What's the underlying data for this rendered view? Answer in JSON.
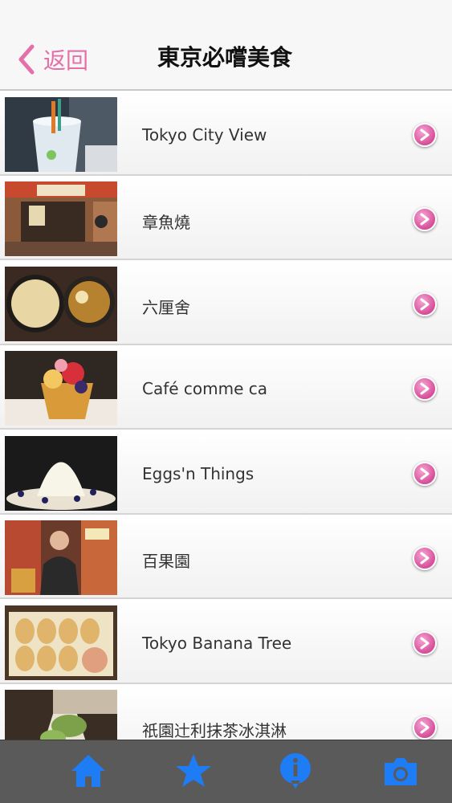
{
  "nav": {
    "back_label": "返回",
    "title": "東京必嚐美食"
  },
  "items": [
    {
      "label": "Tokyo City View",
      "thumb": "cocktail-drink-photo"
    },
    {
      "label": "章魚燒",
      "thumb": "takoyaki-stall-photo"
    },
    {
      "label": "六厘舍",
      "thumb": "tsukemen-noodles-photo"
    },
    {
      "label": "Café comme ca",
      "thumb": "fruit-tart-photo"
    },
    {
      "label": "Eggs'n Things",
      "thumb": "whipped-cream-pancakes-photo"
    },
    {
      "label": "百果園",
      "thumb": "fruit-shop-vendor-photo"
    },
    {
      "label": "Tokyo Banana Tree",
      "thumb": "banana-cakes-box-photo"
    },
    {
      "label": "祇園辻利抹茶冰淇淋",
      "thumb": "matcha-ice-cream-photo"
    }
  ],
  "tabbar": {
    "tabs": [
      {
        "name": "home",
        "icon": "home-icon"
      },
      {
        "name": "favorites",
        "icon": "star-icon"
      },
      {
        "name": "info",
        "icon": "info-icon"
      },
      {
        "name": "camera",
        "icon": "camera-icon"
      }
    ]
  },
  "colors": {
    "accent": "#e56fa8",
    "tab_icon": "#1e7cf5",
    "tab_bar": "#5a5a5a"
  }
}
